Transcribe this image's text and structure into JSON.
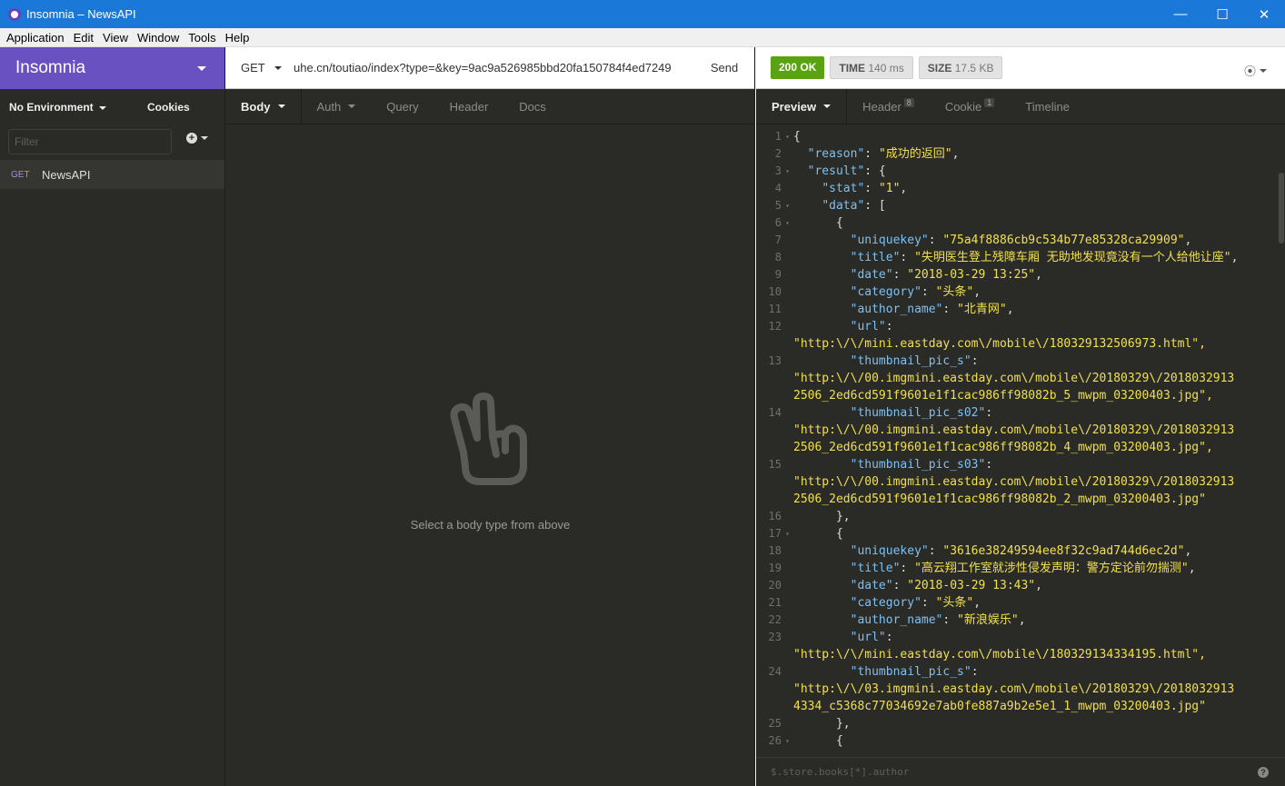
{
  "window": {
    "title": "Insomnia – NewsAPI",
    "minimize": "—",
    "maximize": "☐",
    "close": "✕"
  },
  "menu": [
    "Application",
    "Edit",
    "View",
    "Window",
    "Tools",
    "Help"
  ],
  "sidebar": {
    "brand": "Insomnia",
    "environment": "No Environment",
    "cookies": "Cookies",
    "filter_placeholder": "Filter",
    "requests": [
      {
        "method": "GET",
        "name": "NewsAPI"
      }
    ]
  },
  "request": {
    "method": "GET",
    "url": "uhe.cn/toutiao/index?type=&key=9ac9a526985bbd20fa150784f4ed7249",
    "send": "Send",
    "tabs": [
      "Body",
      "Auth",
      "Query",
      "Header",
      "Docs"
    ],
    "empty_message": "Select a body type from above"
  },
  "response": {
    "status": "200 OK",
    "time_label": "TIME",
    "time_value": "140 ms",
    "size_label": "SIZE",
    "size_value": "17.5 KB",
    "history_icon": "⦿",
    "tabs": [
      {
        "label": "Preview"
      },
      {
        "label": "Header",
        "badge": "8"
      },
      {
        "label": "Cookie",
        "badge": "1"
      },
      {
        "label": "Timeline"
      }
    ],
    "filter_placeholder": "$.store.books[*].author",
    "help": "?"
  },
  "code_lines": [
    {
      "n": "1",
      "f": "▾",
      "i": 0,
      "parts": [
        [
          "p",
          "{"
        ]
      ]
    },
    {
      "n": "2",
      "f": "",
      "i": 2,
      "parts": [
        [
          "k",
          "\"reason\""
        ],
        [
          "p",
          ": "
        ],
        [
          "s",
          "\"成功的返回\""
        ],
        [
          "p",
          ","
        ]
      ]
    },
    {
      "n": "3",
      "f": "▾",
      "i": 2,
      "parts": [
        [
          "k",
          "\"result\""
        ],
        [
          "p",
          ": {"
        ]
      ]
    },
    {
      "n": "4",
      "f": "",
      "i": 4,
      "parts": [
        [
          "k",
          "\"stat\""
        ],
        [
          "p",
          ": "
        ],
        [
          "s",
          "\"1\""
        ],
        [
          "p",
          ","
        ]
      ]
    },
    {
      "n": "5",
      "f": "▾",
      "i": 4,
      "parts": [
        [
          "k",
          "\"data\""
        ],
        [
          "p",
          ": ["
        ]
      ]
    },
    {
      "n": "6",
      "f": "▾",
      "i": 6,
      "parts": [
        [
          "p",
          "{"
        ]
      ]
    },
    {
      "n": "7",
      "f": "",
      "i": 8,
      "parts": [
        [
          "k",
          "\"uniquekey\""
        ],
        [
          "p",
          ": "
        ],
        [
          "s",
          "\"75a4f8886cb9c534b77e85328ca29909\""
        ],
        [
          "p",
          ","
        ]
      ]
    },
    {
      "n": "8",
      "f": "",
      "i": 8,
      "parts": [
        [
          "k",
          "\"title\""
        ],
        [
          "p",
          ": "
        ],
        [
          "s",
          "\"失明医生登上残障车厢 无助地发现竟没有一个人给他让座\""
        ],
        [
          "p",
          ","
        ]
      ]
    },
    {
      "n": "9",
      "f": "",
      "i": 8,
      "parts": [
        [
          "k",
          "\"date\""
        ],
        [
          "p",
          ": "
        ],
        [
          "s",
          "\"2018-03-29 13:25\""
        ],
        [
          "p",
          ","
        ]
      ]
    },
    {
      "n": "10",
      "f": "",
      "i": 8,
      "parts": [
        [
          "k",
          "\"category\""
        ],
        [
          "p",
          ": "
        ],
        [
          "s",
          "\"头条\""
        ],
        [
          "p",
          ","
        ]
      ]
    },
    {
      "n": "11",
      "f": "",
      "i": 8,
      "parts": [
        [
          "k",
          "\"author_name\""
        ],
        [
          "p",
          ": "
        ],
        [
          "s",
          "\"北青网\""
        ],
        [
          "p",
          ","
        ]
      ]
    },
    {
      "n": "12",
      "f": "",
      "i": 8,
      "parts": [
        [
          "k",
          "\"url\""
        ],
        [
          "p",
          ":"
        ]
      ],
      "wrap": [
        "\"http:\\/\\/mini.eastday.com\\/mobile\\/180329132506973.html\","
      ]
    },
    {
      "n": "13",
      "f": "",
      "i": 8,
      "parts": [
        [
          "k",
          "\"thumbnail_pic_s\""
        ],
        [
          "p",
          ":"
        ]
      ],
      "wrap": [
        "\"http:\\/\\/00.imgmini.eastday.com\\/mobile\\/20180329\\/2018032913",
        "2506_2ed6cd591f9601e1f1cac986ff98082b_5_mwpm_03200403.jpg\","
      ]
    },
    {
      "n": "14",
      "f": "",
      "i": 8,
      "parts": [
        [
          "k",
          "\"thumbnail_pic_s02\""
        ],
        [
          "p",
          ":"
        ]
      ],
      "wrap": [
        "\"http:\\/\\/00.imgmini.eastday.com\\/mobile\\/20180329\\/2018032913",
        "2506_2ed6cd591f9601e1f1cac986ff98082b_4_mwpm_03200403.jpg\","
      ]
    },
    {
      "n": "15",
      "f": "",
      "i": 8,
      "parts": [
        [
          "k",
          "\"thumbnail_pic_s03\""
        ],
        [
          "p",
          ":"
        ]
      ],
      "wrap": [
        "\"http:\\/\\/00.imgmini.eastday.com\\/mobile\\/20180329\\/2018032913",
        "2506_2ed6cd591f9601e1f1cac986ff98082b_2_mwpm_03200403.jpg\""
      ]
    },
    {
      "n": "16",
      "f": "",
      "i": 6,
      "parts": [
        [
          "p",
          "},"
        ]
      ]
    },
    {
      "n": "17",
      "f": "▾",
      "i": 6,
      "parts": [
        [
          "p",
          "{"
        ]
      ]
    },
    {
      "n": "18",
      "f": "",
      "i": 8,
      "parts": [
        [
          "k",
          "\"uniquekey\""
        ],
        [
          "p",
          ": "
        ],
        [
          "s",
          "\"3616e38249594ee8f32c9ad744d6ec2d\""
        ],
        [
          "p",
          ","
        ]
      ]
    },
    {
      "n": "19",
      "f": "",
      "i": 8,
      "parts": [
        [
          "k",
          "\"title\""
        ],
        [
          "p",
          ": "
        ],
        [
          "s",
          "\"高云翔工作室就涉性侵发声明：警方定论前勿揣测\""
        ],
        [
          "p",
          ","
        ]
      ]
    },
    {
      "n": "20",
      "f": "",
      "i": 8,
      "parts": [
        [
          "k",
          "\"date\""
        ],
        [
          "p",
          ": "
        ],
        [
          "s",
          "\"2018-03-29 13:43\""
        ],
        [
          "p",
          ","
        ]
      ]
    },
    {
      "n": "21",
      "f": "",
      "i": 8,
      "parts": [
        [
          "k",
          "\"category\""
        ],
        [
          "p",
          ": "
        ],
        [
          "s",
          "\"头条\""
        ],
        [
          "p",
          ","
        ]
      ]
    },
    {
      "n": "22",
      "f": "",
      "i": 8,
      "parts": [
        [
          "k",
          "\"author_name\""
        ],
        [
          "p",
          ": "
        ],
        [
          "s",
          "\"新浪娱乐\""
        ],
        [
          "p",
          ","
        ]
      ]
    },
    {
      "n": "23",
      "f": "",
      "i": 8,
      "parts": [
        [
          "k",
          "\"url\""
        ],
        [
          "p",
          ":"
        ]
      ],
      "wrap": [
        "\"http:\\/\\/mini.eastday.com\\/mobile\\/180329134334195.html\","
      ]
    },
    {
      "n": "24",
      "f": "",
      "i": 8,
      "parts": [
        [
          "k",
          "\"thumbnail_pic_s\""
        ],
        [
          "p",
          ":"
        ]
      ],
      "wrap": [
        "\"http:\\/\\/03.imgmini.eastday.com\\/mobile\\/20180329\\/2018032913",
        "4334_c5368c77034692e7ab0fe887a9b2e5e1_1_mwpm_03200403.jpg\""
      ]
    },
    {
      "n": "25",
      "f": "",
      "i": 6,
      "parts": [
        [
          "p",
          "},"
        ]
      ]
    },
    {
      "n": "26",
      "f": "▾",
      "i": 6,
      "parts": [
        [
          "p",
          "{"
        ]
      ]
    }
  ],
  "colors": {
    "brand": "#6a51c1",
    "status_ok": "#59a210",
    "json_key": "#7ec0f0",
    "json_string": "#f0e04e"
  }
}
